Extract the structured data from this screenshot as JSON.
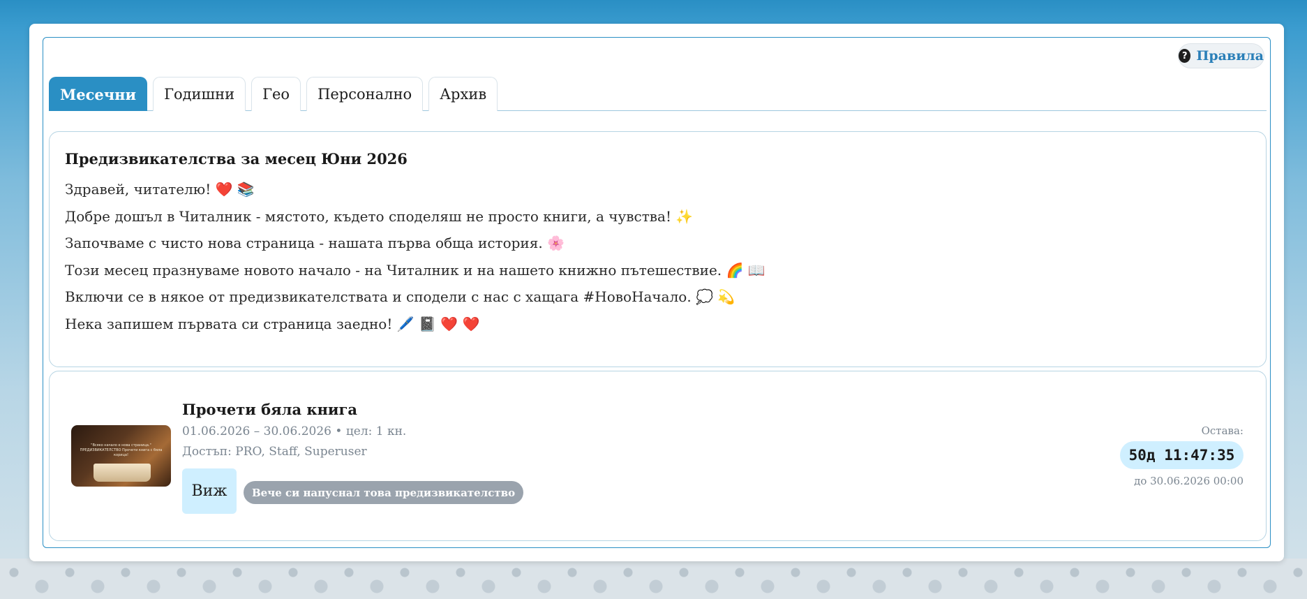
{
  "header": {
    "rules_label": "Правила",
    "rules_icon": "question-circle-icon"
  },
  "tabs": [
    {
      "label": "Месечни",
      "active": true
    },
    {
      "label": "Годишни",
      "active": false
    },
    {
      "label": "Гео",
      "active": false
    },
    {
      "label": "Персонално",
      "active": false
    },
    {
      "label": "Архив",
      "active": false
    }
  ],
  "intro": {
    "title": "Предизвикателства за месец Юни 2026",
    "lines": [
      "Здравей, читателю! ❤️ 📚",
      "Добре дошъл в Читалник - мястото, където споделяш не просто книги, а чувства! ✨",
      "Започваме с чисто нова страница - нашата първа обща история. 🌸",
      "Този месец празнуваме новото начало - на Читалник и на нашето книжно пътешествие. 🌈 📖",
      "Включи се в някое от предизвикателствата и сподели с нас с хащага #НовоНачало. 💭 💫",
      "Нека запишем първата си страница заедно! 🖊️ 📓 ❤️ ❤️"
    ]
  },
  "challenge": {
    "thumb_text": "\"Всяко начало е нова страница.\" ПРЕДИЗВИКАТЕЛСТВО Прочети книга с бяла корица!",
    "title": "Прочети бяла книга",
    "dates": "01.06.2026 – 30.06.2026 • цел: 1 кн.",
    "access": "Достъп: PRO, Staff, Superuser",
    "view_label": "Виж",
    "quit_badge": "Вече си напуснал това предизвикателство",
    "remaining_label": "Остава:",
    "countdown": "50д 11:47:35",
    "until": "до 30.06.2026 00:00"
  },
  "colors": {
    "accent": "#2a8fc4",
    "badge": "#9aa3ad",
    "countdown_bg": "#cfefff"
  }
}
